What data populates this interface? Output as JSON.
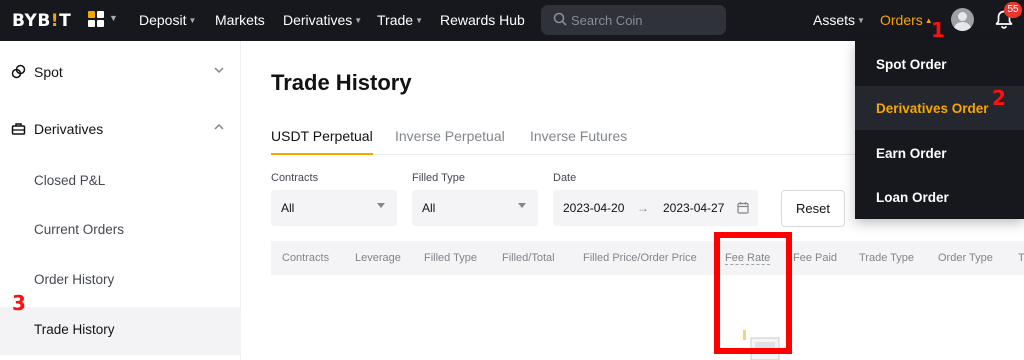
{
  "brand": {
    "logo_pre": "BYB",
    "logo_mid": "!",
    "logo_post": "T",
    "accent_color": "#f7a600",
    "topbar_bg": "#17181e"
  },
  "topnav": {
    "items": [
      {
        "label": "Deposit",
        "has_caret": true
      },
      {
        "label": "Markets",
        "has_caret": false
      },
      {
        "label": "Derivatives",
        "has_caret": true
      },
      {
        "label": "Trade",
        "has_caret": true
      },
      {
        "label": "Rewards Hub",
        "has_caret": false
      }
    ],
    "search_placeholder": "Search Coin",
    "assets_label": "Assets",
    "orders_label": "Orders",
    "notification_count": "55",
    "icons": [
      "apps-grid-icon",
      "search-icon",
      "user-avatar-icon",
      "bell-icon"
    ]
  },
  "orders_menu": {
    "items": [
      {
        "label": "Spot Order",
        "active": false
      },
      {
        "label": "Derivatives Order",
        "active": true
      },
      {
        "label": "Earn Order",
        "active": false
      },
      {
        "label": "Loan Order",
        "active": false
      }
    ]
  },
  "sidebar": {
    "sections": [
      {
        "label": "Spot",
        "expanded": false
      },
      {
        "label": "Derivatives",
        "expanded": true
      }
    ],
    "items": [
      {
        "label": "Closed P&L",
        "active": false
      },
      {
        "label": "Current Orders",
        "active": false
      },
      {
        "label": "Order History",
        "active": false
      },
      {
        "label": "Trade History",
        "active": true
      }
    ]
  },
  "main": {
    "title": "Trade History",
    "tabs": [
      {
        "label": "USDT Perpetual",
        "active": true
      },
      {
        "label": "Inverse Perpetual",
        "active": false
      },
      {
        "label": "Inverse Futures",
        "active": false
      }
    ],
    "filters": {
      "contracts": {
        "label": "Contracts",
        "value": "All"
      },
      "filled_type": {
        "label": "Filled Type",
        "value": "All"
      },
      "date": {
        "label": "Date",
        "start": "2023-04-20",
        "arrow": "→",
        "end": "2023-04-27"
      },
      "reset_label": "Reset"
    },
    "columns": [
      "Contracts",
      "Leverage",
      "Filled Type",
      "Filled/Total",
      "Filled Price/Order Price",
      "Fee Rate",
      "Fee Paid",
      "Trade Type",
      "Order Type",
      "T"
    ]
  },
  "annotations": {
    "step1": "1",
    "step2": "2",
    "step3": "3",
    "highlight_color": "#ff0000"
  }
}
